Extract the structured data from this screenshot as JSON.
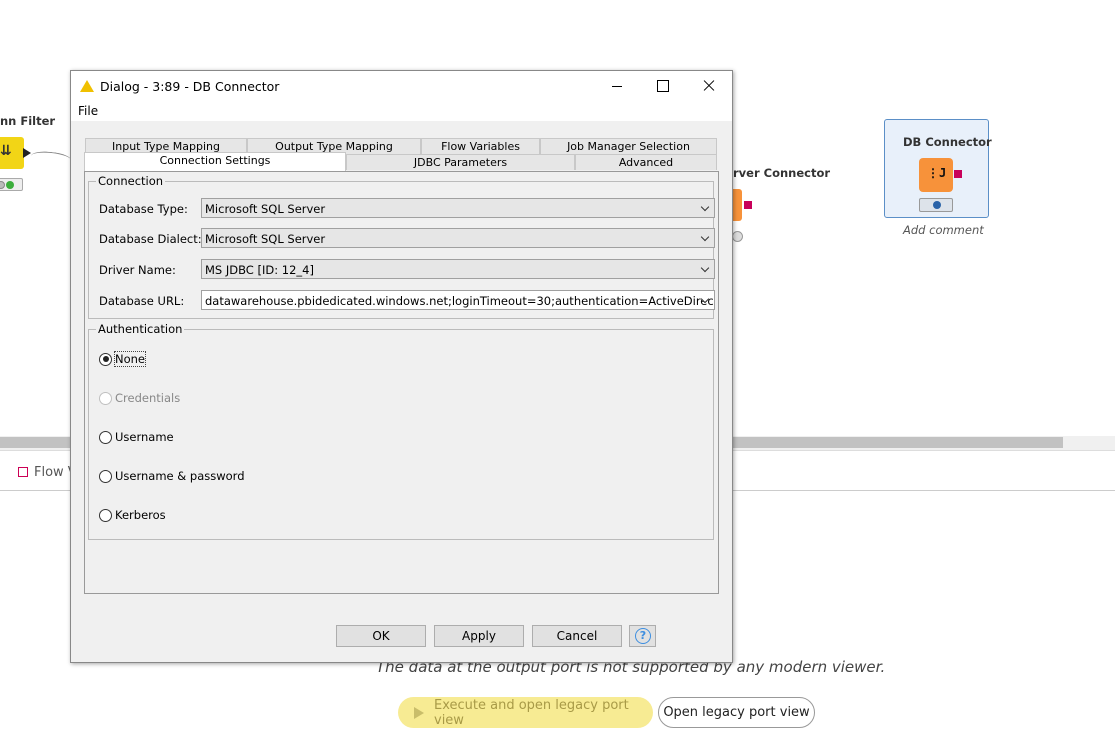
{
  "canvas": {
    "filter_node": {
      "title": "nn Filter"
    },
    "sql_server_node": {
      "title": "rver Connector"
    },
    "db_connector_node": {
      "title": "DB Connector",
      "comment": "Add comment"
    }
  },
  "bottom_panel": {
    "flow_tab_label": "Flow V",
    "message": "The data at the output port is not supported by any modern viewer.",
    "execute_legacy_label": "Execute and open legacy port view",
    "open_legacy_label": "Open legacy port view"
  },
  "dialog": {
    "title": "Dialog - 3:89 - DB Connector",
    "menu": {
      "file": "File"
    },
    "tabs_back": [
      "Input Type Mapping",
      "Output Type Mapping",
      "Flow Variables",
      "Job Manager Selection"
    ],
    "tabs_front": [
      "Connection Settings",
      "JDBC Parameters",
      "Advanced"
    ],
    "selected_tab": "Connection Settings",
    "connection": {
      "group_label": "Connection",
      "database_type_label": "Database Type:",
      "database_type_value": "Microsoft SQL Server",
      "database_dialect_label": "Database Dialect:",
      "database_dialect_value": "Microsoft SQL Server",
      "driver_name_label": "Driver Name:",
      "driver_name_value": "MS JDBC [ID: 12_4]",
      "database_url_label": "Database URL:",
      "database_url_value": "datawarehouse.pbidedicated.windows.net;loginTimeout=30;authentication=ActiveDirectoryPassword"
    },
    "authentication": {
      "group_label": "Authentication",
      "options": [
        "None",
        "Credentials",
        "Username",
        "Username & password",
        "Kerberos"
      ],
      "selected": "None"
    },
    "buttons": {
      "ok": "OK",
      "apply": "Apply",
      "cancel": "Cancel",
      "help": "?"
    }
  },
  "colors": {
    "filter_node": "#f2d516",
    "connector_node": "#f7923a",
    "db_port": "#c8005a",
    "selected_node_border": "#5b8fc7",
    "legacy_button": "#f7eb93",
    "warning_icon": "#f0c000"
  }
}
